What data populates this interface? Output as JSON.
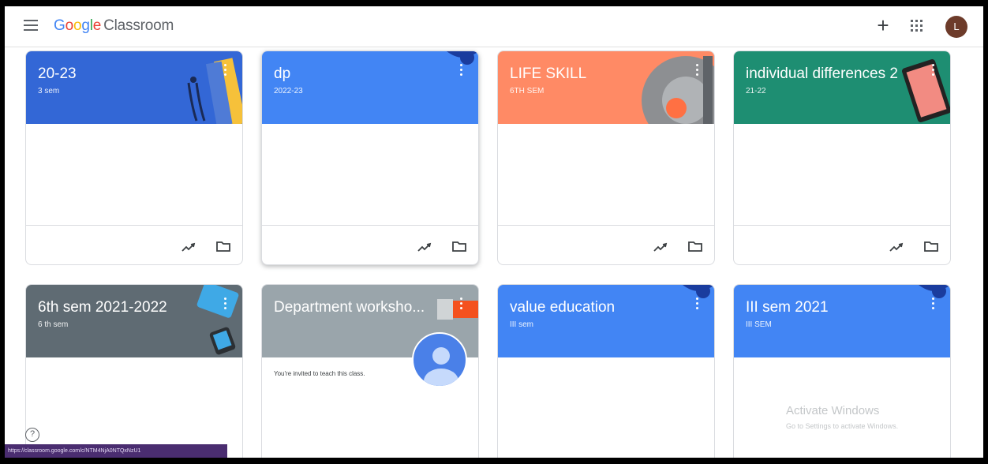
{
  "app": {
    "brand_letters": [
      "G",
      "o",
      "o",
      "g",
      "l",
      "e"
    ],
    "product_name": "Classroom",
    "avatar_initial": "L"
  },
  "classes": [
    {
      "title": "20-23",
      "section": "3 sem",
      "color": "#3367d6",
      "actions": [
        "trending-up-icon",
        "folder-icon"
      ]
    },
    {
      "title": "dp",
      "section": "2022-23",
      "color": "#4285f4",
      "actions": [
        "trending-up-icon",
        "folder-icon"
      ]
    },
    {
      "title": "LIFE SKILL",
      "section": "6TH SEM",
      "color": "#ff8a65",
      "actions": [
        "trending-up-icon",
        "folder-icon"
      ]
    },
    {
      "title": "individual differences 2",
      "section": "21-22",
      "color": "#1e8e72",
      "actions": [
        "trending-up-icon",
        "folder-icon"
      ]
    },
    {
      "title": "6th sem 2021-2022",
      "section": "6 th sem",
      "color": "#5f6b73"
    },
    {
      "title": "Department worksho...",
      "section": "",
      "color": "#9aa5ab",
      "invite_text": "You're invited to teach this class."
    },
    {
      "title": "value education",
      "section": "III sem",
      "color": "#4285f4"
    },
    {
      "title": "III sem 2021",
      "section": "III SEM",
      "color": "#4285f4"
    }
  ],
  "status_url": "https://classroom.google.com/c/NTM4NjA0NTQxNzU1",
  "watermark": {
    "line1": "Activate Windows",
    "line2": "Go to Settings to activate Windows."
  }
}
